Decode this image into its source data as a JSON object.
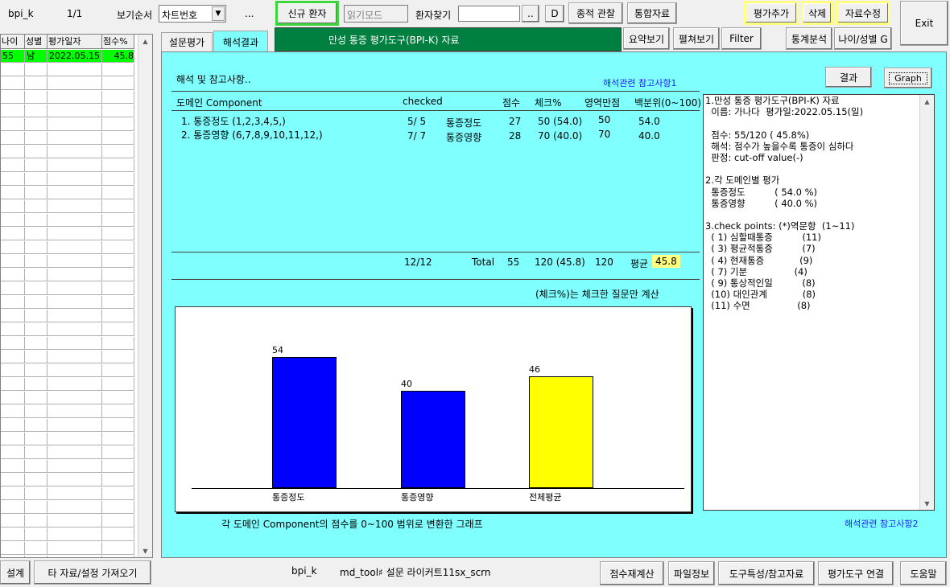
{
  "toolbar": {
    "app_name": "bpi_k",
    "page_count": "1/1",
    "sort_label": "보기순서",
    "sort_value": "차트번호",
    "ellipsis": "...",
    "new_patient": "신규 환자",
    "read_mode": "읽기모드",
    "patient_search_label": "환자찾기",
    "search_btn": "..",
    "d_btn": "D",
    "trend_btn": "종적 관찰",
    "integrated_btn": "통합자료",
    "add_eval_btn": "평가추가",
    "delete_btn": "삭제",
    "edit_btn": "자료수정",
    "exit_btn": "Exit"
  },
  "grid": {
    "headers": [
      "나이",
      "성별",
      "평가일자",
      "점수%"
    ],
    "rows": [
      [
        "55",
        "남",
        "2022.05.15",
        "45.8"
      ]
    ],
    "selected_color": "#00ff00"
  },
  "tabs": {
    "survey": "설문평가",
    "result": "해석결과"
  },
  "title_banner": "만성 통증 평가도구(BPI-K) 자료",
  "view_buttons": {
    "summary": "요약보기",
    "expand": "펼쳐보기",
    "filter": "Filter",
    "stats": "통계분석",
    "age_sex": "나이/성별 G"
  },
  "panel": {
    "heading": "해석 및 참고사항..",
    "ref1": "해석관련 참고사항1",
    "ref2": "해석관련 참고사항2",
    "result_btn": "결과",
    "graph_btn": "Graph",
    "columns": {
      "domain": "도메인 Component",
      "checked": "checked",
      "score": "점수",
      "check_pct": "체크%",
      "max_score": "영역만점",
      "percentile": "백분위(0~100)"
    },
    "rows": [
      {
        "domain": "1. 통증정도 (1,2,3,4,5,)",
        "checked": "5/ 5",
        "name": "통증정도",
        "score": "27",
        "check_pct": "50 (54.0)",
        "max_score": "50",
        "percentile": "54.0"
      },
      {
        "domain": "2. 통증영향 (6,7,8,9,10,11,12,)",
        "checked": "7/ 7",
        "name": "통증영향",
        "score": "28",
        "check_pct": "70 (40.0)",
        "max_score": "70",
        "percentile": "40.0"
      }
    ],
    "total": {
      "checked": "12/12",
      "label": "Total",
      "score": "55",
      "check_pct": "120 (45.8)",
      "max_score": "120",
      "avg_label": "평균",
      "avg_value": "45.8"
    },
    "check_note": "(체크%)는 체크한 질문만 계산",
    "chart_caption": "각 도메인 Component의 점수를 0~100 범위로 변환한 그래프"
  },
  "report_lines": [
    "1.만성 통증 평가도구(BPI-K) 자료",
    "  이름: 가나다  평가일:2022.05.15(일)",
    "",
    "  점수: 55/120 ( 45.8%)",
    "  해석: 점수가 높을수록 통증이 심하다",
    "  판정: cut-off value(-)",
    "",
    "2.각 도메인별 평가",
    "  통증정도          ( 54.0 %)",
    "  통증영향          ( 40.0 %)",
    "",
    "3.check points: (*)역문항  (1~11)",
    "  ( 1) 심할때통증          (11)",
    "  ( 3) 평균적통증          (7)",
    "  ( 4) 현재통증            (9)",
    "  ( 7) 기분                (4)",
    "  ( 9) 통상적인일          (8)",
    "  (10) 대인관계            (8)",
    "  (11) 수면                (8)"
  ],
  "chart_data": {
    "type": "bar",
    "categories": [
      "통증정도",
      "통증영향",
      "전체평균"
    ],
    "values": [
      54,
      40,
      46
    ],
    "colors": [
      "#0000ff",
      "#0000ff",
      "#ffff00"
    ],
    "ylim": [
      0,
      100
    ]
  },
  "bottom": {
    "settings_btn": "설계",
    "import_btn": "타 자료/설정 가져오기",
    "status_app": "bpi_k",
    "status_tool": "md_tool♯  설문 라이커트11sx_scrn",
    "recalc_btn": "점수재계산",
    "fileinfo_btn": "파일정보",
    "tool_ref_btn": "도구특성/참고자료",
    "link_btn": "평가도구 연결",
    "help_btn": "도움말"
  }
}
